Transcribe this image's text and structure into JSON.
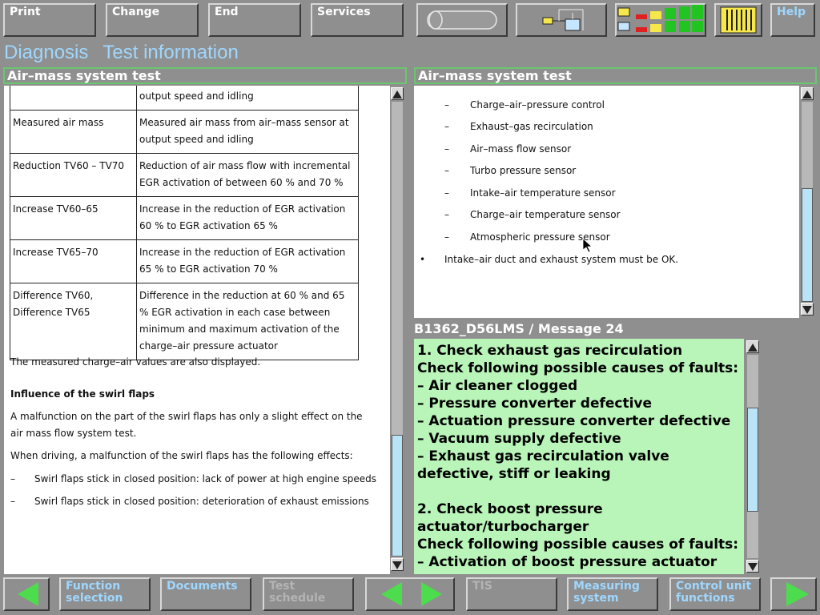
{
  "top_buttons": {
    "print": "Print",
    "change": "Change",
    "end": "End",
    "services": "Services",
    "help": "Help"
  },
  "heading": {
    "part1": "Diagnosis",
    "part2": "Test information"
  },
  "left_panel": {
    "title": "Air–mass system test",
    "table": [
      {
        "name": "",
        "desc": "output speed and idling"
      },
      {
        "name": "Measured air mass",
        "desc": "Measured air mass from air–mass sensor at output speed and idling"
      },
      {
        "name": "Reduction TV60 – TV70",
        "desc": " Reduction of air mass flow with incremental EGR activation of between 60 % and 70 %"
      },
      {
        "name": "Increase TV60–65",
        "desc": "Increase in the reduction of EGR activation 60 % to EGR activation 65 %"
      },
      {
        "name": "Increase TV65–70",
        "desc": "Increase in the reduction of EGR activation 65 % to EGR activation 70 %"
      },
      {
        "name": "Difference TV60, Difference TV65",
        "desc": "Difference in the reduction at 60 % and 65 % EGR activation in each case between minimum and maximum activation of the charge–air pressure actuator"
      }
    ],
    "note": "The measured charge–air values are also displayed.",
    "swirl_heading": "Influence of the swirl flaps",
    "swirl_para1": "A malfunction on the part of the swirl flaps has only a slight effect on the air mass flow system test.",
    "swirl_para2": "When driving, a malfunction of the swirl flaps has the following effects:",
    "swirl_items": [
      "Swirl flaps stick in closed position: lack of power at high engine speeds",
      "Swirl flaps stick in closed position: deterioration of exhaust emissions"
    ],
    "dash": "–"
  },
  "right_panel": {
    "title": "Air–mass system test",
    "items": [
      "Charge–air–pressure control",
      "Exhaust–gas recirculation",
      "Air–mass flow sensor",
      "Turbo pressure sensor",
      "Intake–air temperature sensor",
      "Charge–air temperature sensor",
      "Atmospheric pressure sensor"
    ],
    "dash": "–",
    "bullet": "•",
    "bullet_text": "Intake–air duct and exhaust system must be OK."
  },
  "message": {
    "title": "B1362_D56LMS / Message 24",
    "lines": [
      "1. Check exhaust gas recirculation",
      "Check following possible causes of faults:",
      "– Air cleaner clogged",
      "– Pressure converter defective",
      "– Actuation pressure converter defective",
      "– Vacuum supply defective",
      "– Exhaust gas recirculation valve defective, stiff or leaking",
      "",
      "2. Check boost pressure actuator/turbocharger",
      "Check following possible causes of faults:",
      "– Activation of boost pressure actuator"
    ]
  },
  "bottom_buttons": {
    "function_selection": "Function selection",
    "documents": "Documents",
    "test_schedule": "Test schedule",
    "tis": "TIS",
    "measuring_system": "Measuring system",
    "control_unit_functions": "Control unit functions"
  },
  "colors": {
    "background": "#8f8f8f",
    "heading": "#9fd7ff",
    "message_bg": "#b9f4b9",
    "panel_border": "#69c76f",
    "nav_arrow": "#4ddc4d"
  },
  "icons": [
    "battery-cylinder-icon",
    "network-connection-icon",
    "signal-level-icon",
    "connector-plug-icon"
  ]
}
